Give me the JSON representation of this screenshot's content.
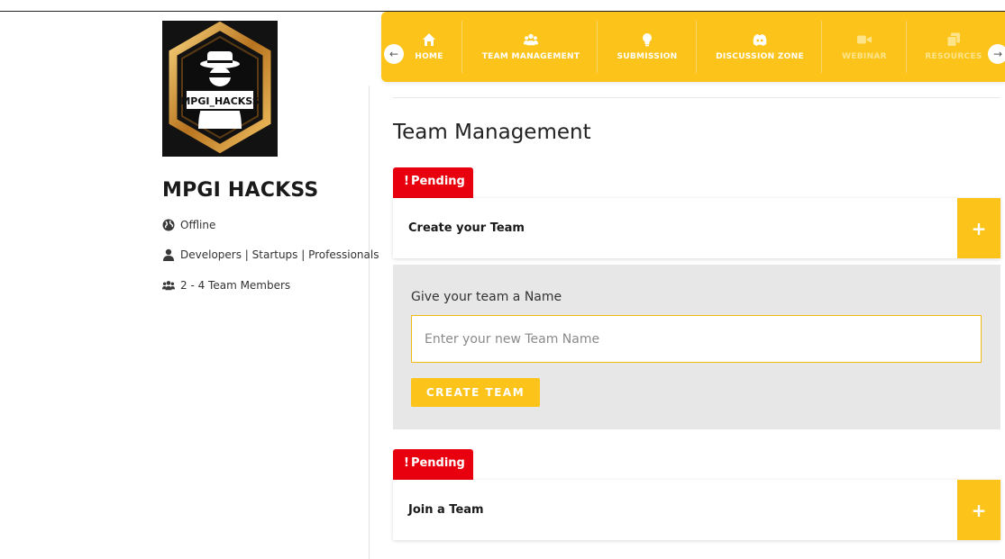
{
  "sidebar": {
    "logo_text": "MPGI_HACKSS",
    "title": "MPGI HACKSS",
    "mode": {
      "icon": "globe-icon",
      "text": "Offline"
    },
    "audience": {
      "icon": "user-icon",
      "text": "Developers | Startups | Professionals"
    },
    "team_size": {
      "icon": "users-icon",
      "text": "2 - 4 Team Members"
    }
  },
  "nav": {
    "items": [
      {
        "label": "HOME",
        "icon": "home-icon"
      },
      {
        "label": "TEAM MANAGEMENT",
        "icon": "users-icon"
      },
      {
        "label": "SUBMISSION",
        "icon": "lightbulb-icon"
      },
      {
        "label": "DISCUSSION ZONE",
        "icon": "discord-icon"
      },
      {
        "label": "WEBINAR",
        "icon": "video-icon"
      },
      {
        "label": "RESOURCES",
        "icon": "copy-icon"
      }
    ],
    "prev_arrow": "←",
    "next_arrow": "→"
  },
  "main": {
    "title": "Team Management",
    "create_section": {
      "status": "Pending",
      "status_mark": "!",
      "header": "Create your Team",
      "toggle": "+",
      "form": {
        "label": "Give your team a Name",
        "input_value": "",
        "placeholder": "Enter your new Team Name",
        "button": "CREATE TEAM"
      }
    },
    "join_section": {
      "status": "Pending",
      "status_mark": "!",
      "header": "Join a Team",
      "toggle": "+"
    }
  },
  "colors": {
    "accent": "#fcc41a",
    "badge": "#e8000e",
    "panel": "#e7e7e7"
  }
}
